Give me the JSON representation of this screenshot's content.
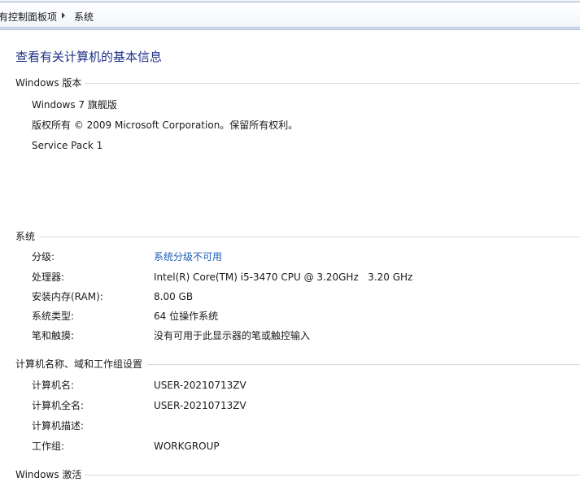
{
  "breadcrumb": {
    "items": [
      "有控制面板项",
      "系统"
    ]
  },
  "page_title": "查看有关计算机的基本信息",
  "windows_edition": {
    "header": "Windows 版本",
    "edition": "Windows 7 旗舰版",
    "copyright": "版权所有 © 2009 Microsoft Corporation。保留所有权利。",
    "service_pack": "Service Pack 1"
  },
  "system": {
    "header": "系统",
    "rows": [
      {
        "label": "分级:",
        "value": "系统分级不可用"
      },
      {
        "label": "处理器:",
        "value": "Intel(R) Core(TM) i5-3470 CPU @ 3.20GHz   3.20 GHz"
      },
      {
        "label": "安装内存(RAM):",
        "value": "8.00 GB"
      },
      {
        "label": "系统类型:",
        "value": "64 位操作系统"
      },
      {
        "label": "笔和触摸:",
        "value": "没有可用于此显示器的笔或触控输入"
      }
    ]
  },
  "computer_name": {
    "header": "计算机名称、域和工作组设置",
    "rows": [
      {
        "label": "计算机名:",
        "value": "USER-20210713ZV"
      },
      {
        "label": "计算机全名:",
        "value": "USER-20210713ZV"
      },
      {
        "label": "计算机描述:",
        "value": ""
      },
      {
        "label": "工作组:",
        "value": "WORKGROUP"
      }
    ]
  },
  "activation": {
    "header": "Windows 激活"
  },
  "colors": {
    "title": "#1e3287",
    "link": "#1c5fb6",
    "rule": "#d5dae1"
  }
}
